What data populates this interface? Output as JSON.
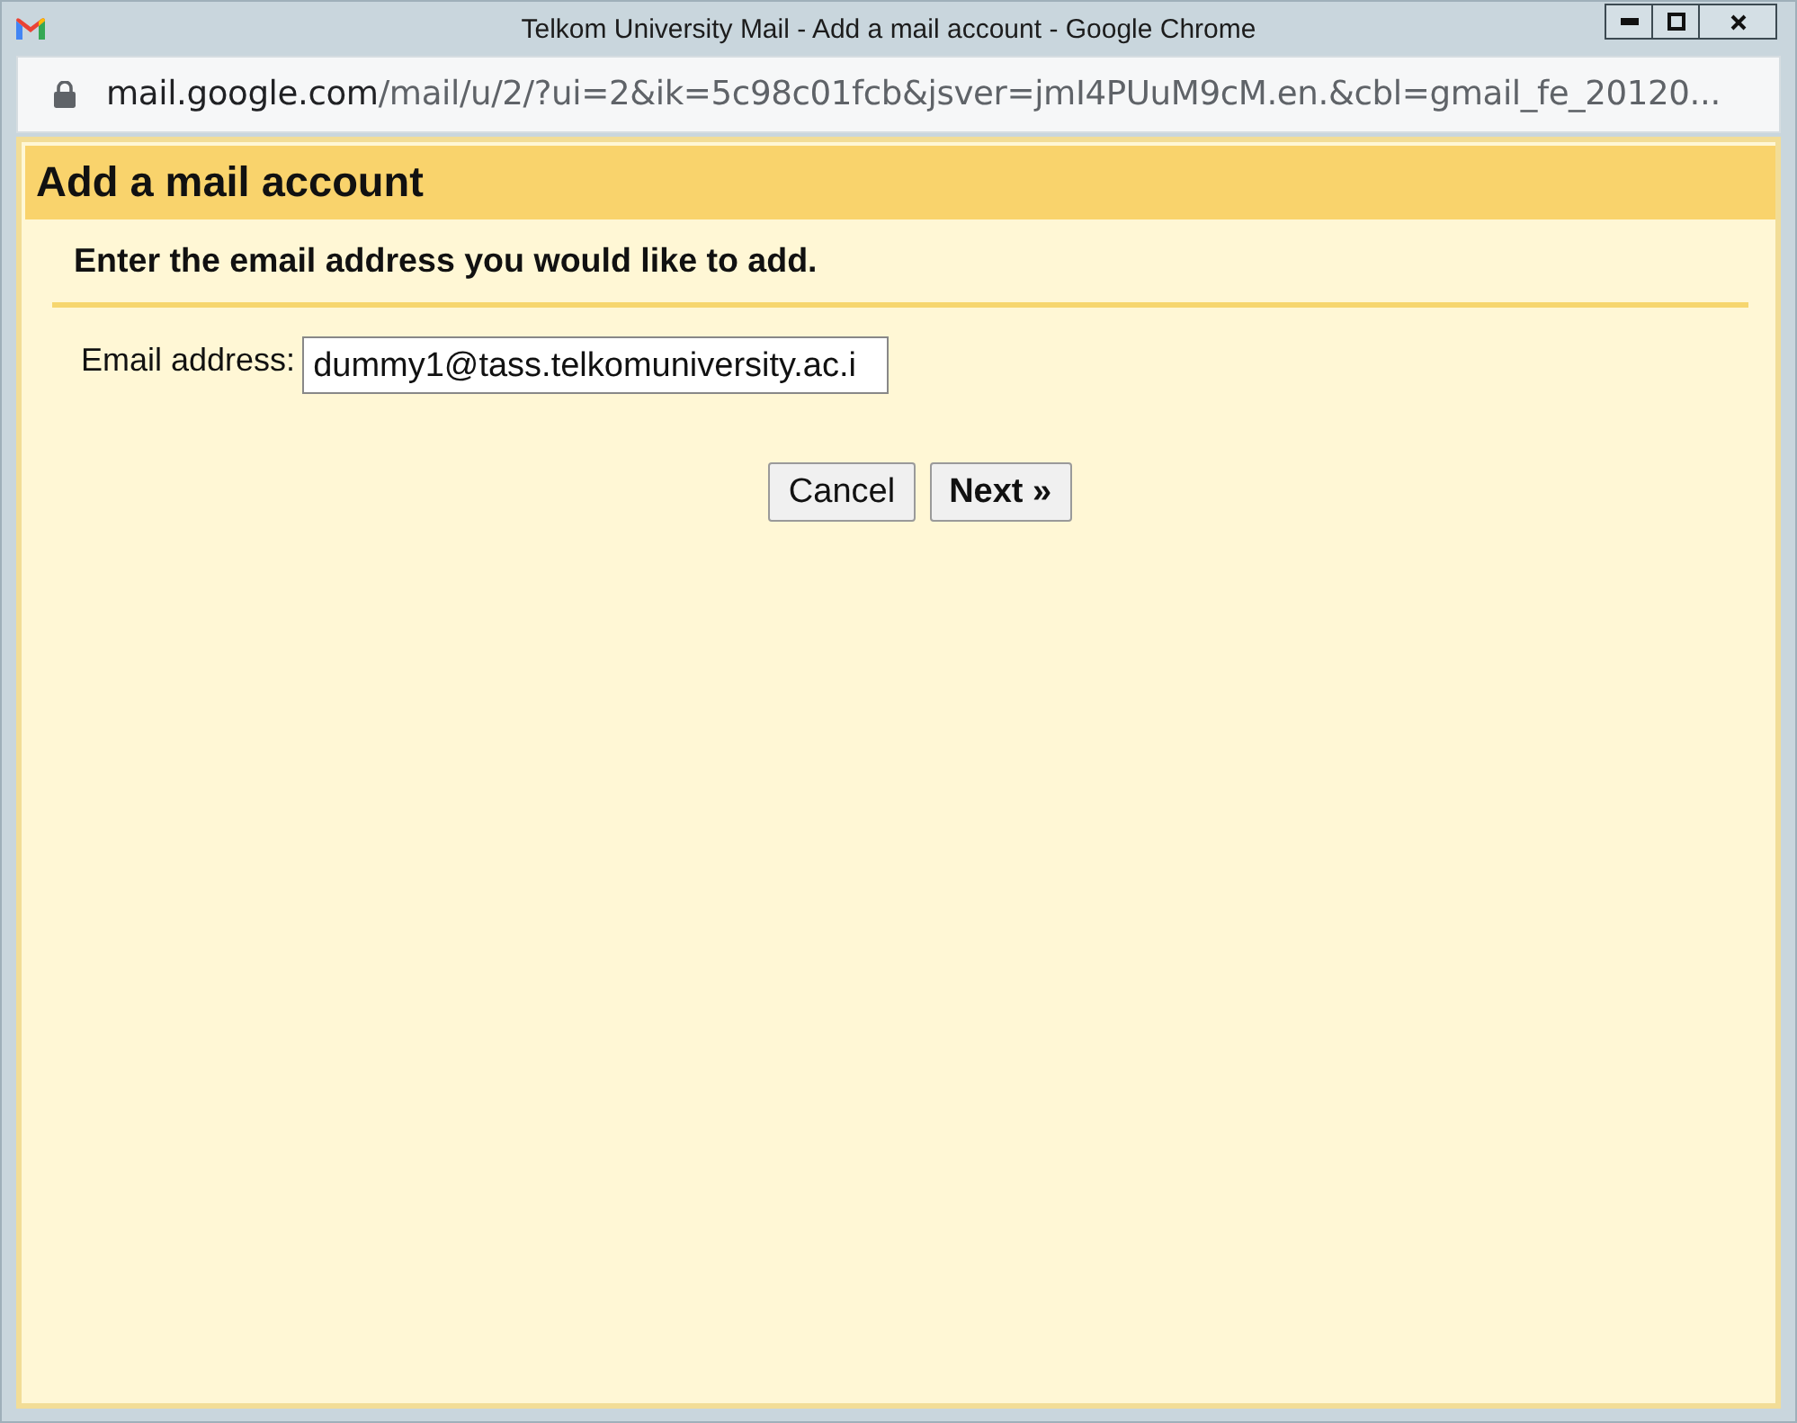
{
  "window": {
    "title": "Telkom University Mail - Add a mail account - Google Chrome"
  },
  "address_bar": {
    "host": "mail.google.com",
    "path": "/mail/u/2/?ui=2&ik=5c98c01fcb&jsver=jmI4PUuM9cM.en.&cbl=gmail_fe_20120..."
  },
  "dialog": {
    "title": "Add a mail account",
    "instruction": "Enter the email address you would like to add.",
    "fields": [
      {
        "label": "Email address:",
        "value": "dummy1@tass.telkomuniversity.ac.i"
      }
    ],
    "buttons": [
      {
        "label": "Cancel",
        "kind": "secondary"
      },
      {
        "label": "Next »",
        "kind": "primary"
      }
    ]
  }
}
